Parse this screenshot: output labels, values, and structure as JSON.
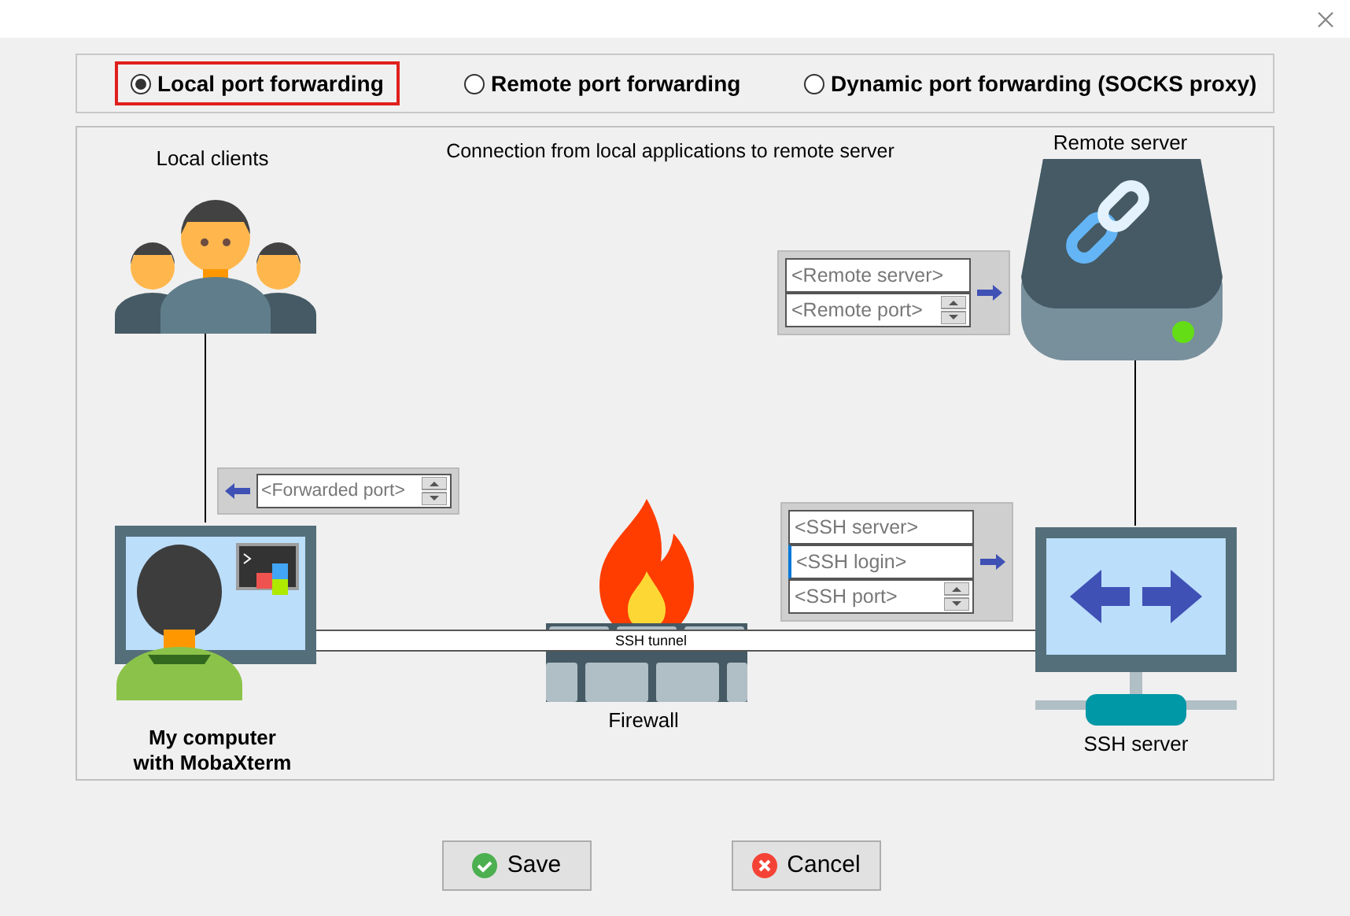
{
  "modes": [
    {
      "label": "Local port forwarding",
      "selected": true
    },
    {
      "label": "Remote port forwarding",
      "selected": false
    },
    {
      "label": "Dynamic port forwarding (SOCKS proxy)",
      "selected": false
    }
  ],
  "diagram": {
    "caption": "Connection from local applications to remote server",
    "local_clients_label": "Local clients",
    "remote_server_label": "Remote server",
    "forwarded_port": {
      "placeholder": "<Forwarded port>"
    },
    "remote_fields": [
      {
        "placeholder": "<Remote server>",
        "spinner": false,
        "focused": false
      },
      {
        "placeholder": "<Remote port>",
        "spinner": true,
        "focused": false
      }
    ],
    "ssh_fields": [
      {
        "placeholder": "<SSH server>",
        "spinner": false,
        "focused": false
      },
      {
        "placeholder": "<SSH login>",
        "spinner": false,
        "focused": true
      },
      {
        "placeholder": "<SSH port>",
        "spinner": true,
        "focused": false
      }
    ],
    "tunnel_label": "SSH tunnel",
    "computer_label": "My computer\nwith MobaXterm",
    "firewall_label": "Firewall",
    "ssh_server_label": "SSH server"
  },
  "buttons": [
    {
      "label": "Save",
      "kind": "save"
    },
    {
      "label": "Cancel",
      "kind": "cancel"
    }
  ]
}
